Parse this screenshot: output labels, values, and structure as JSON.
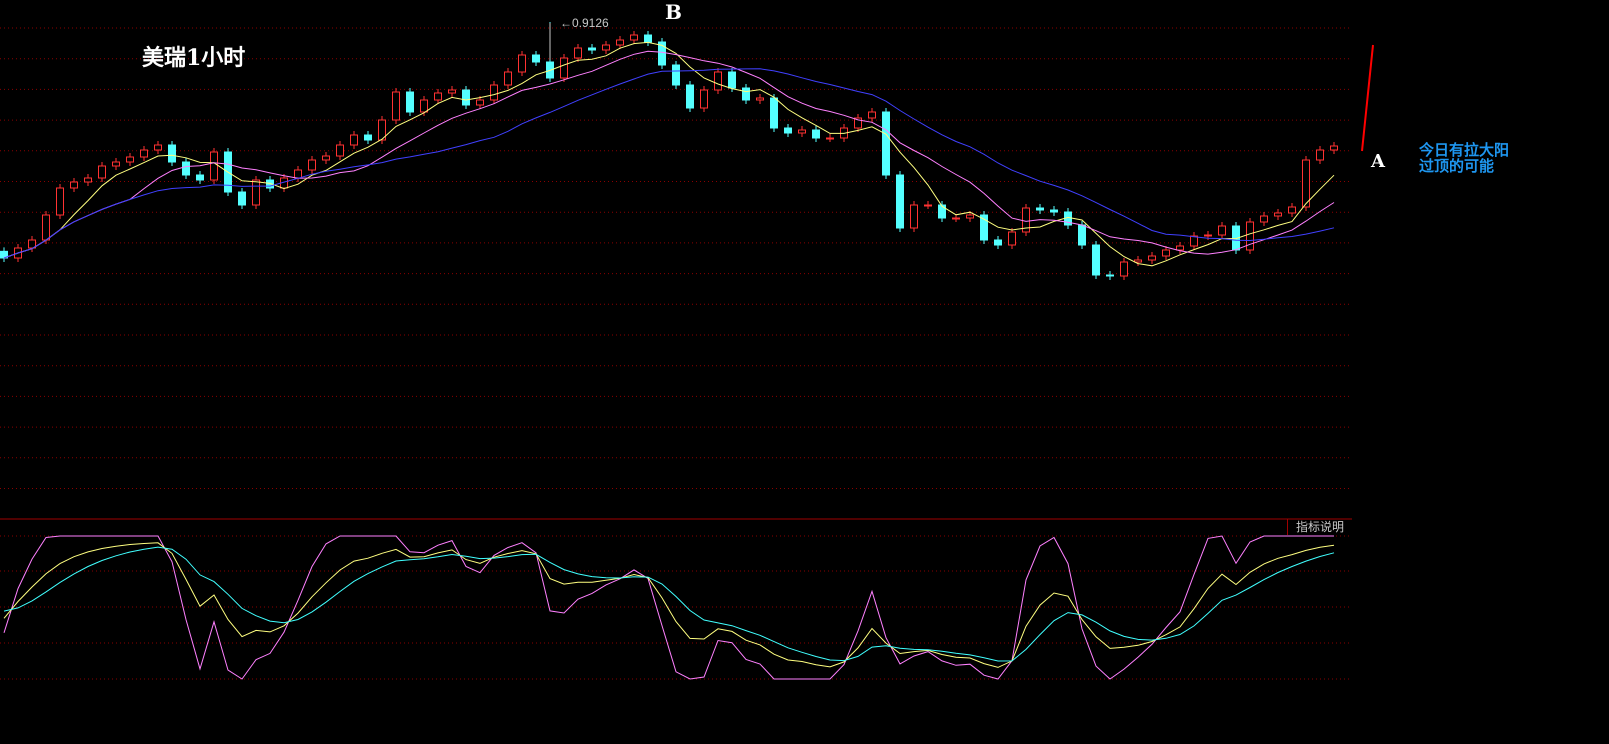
{
  "chart_data": {
    "type": "candlestick",
    "title": "美瑞1小时",
    "closes": [
      0.90552,
      0.90582,
      0.90606,
      0.90681,
      0.90762,
      0.9078,
      0.90792,
      0.90828,
      0.9084,
      0.90855,
      0.90876,
      0.90891,
      0.9084,
      0.90801,
      0.90786,
      0.9087,
      0.9075,
      0.90711,
      0.90786,
      0.90762,
      0.90792,
      0.90816,
      0.90846,
      0.90858,
      0.90891,
      0.90921,
      0.90906,
      0.90966,
      0.9105,
      0.9099,
      0.91026,
      0.91047,
      0.91056,
      0.91011,
      0.91026,
      0.91071,
      0.9111,
      0.91161,
      0.9114,
      0.91092,
      0.91152,
      0.91182,
      0.91176,
      0.91191,
      0.91206,
      0.91221,
      0.912,
      0.91131,
      0.91071,
      0.91002,
      0.91056,
      0.9111,
      0.91062,
      0.91026,
      0.91032,
      0.90942,
      0.90927,
      0.90936,
      0.90912,
      0.90912,
      0.90942,
      0.90972,
      0.9099,
      0.90801,
      0.90642,
      0.90711,
      0.90711,
      0.90672,
      0.90672,
      0.90681,
      0.90606,
      0.90591,
      0.9063,
      0.90702,
      0.90696,
      0.9069,
      0.90651,
      0.90591,
      0.90501,
      0.90498,
      0.9054,
      0.90546,
      0.90558,
      0.90576,
      0.90588,
      0.90618,
      0.90621,
      0.90648,
      0.90576,
      0.9066,
      0.90678,
      0.90687,
      0.90705,
      0.90846,
      0.90876,
      0.90888
    ],
    "peak": {
      "index": 39,
      "value": 0.9126,
      "label": "0.9126"
    },
    "moving_averages": [
      {
        "name": "MA5",
        "period": 5,
        "color": "#ffff80"
      },
      {
        "name": "MA10",
        "period": 10,
        "color": "#ff80ff"
      },
      {
        "name": "MA20",
        "period": 20,
        "color": "#4040ff"
      }
    ],
    "indicator": {
      "type": "KDJ",
      "period": 9,
      "ylim": [
        0,
        100
      ],
      "colors": {
        "K": "#ffff80",
        "D": "#40ffff",
        "J": "#ff80ff"
      }
    },
    "up_color": "#ff3232",
    "down_color": "#54ffff",
    "grid": true
  },
  "annotations": {
    "point_b": "B",
    "point_a": "A",
    "note_line1": "今日有拉大阳",
    "note_line2": "过顶的可能",
    "arrow_color": "#ff0000"
  },
  "indicator_label": "指标说明"
}
